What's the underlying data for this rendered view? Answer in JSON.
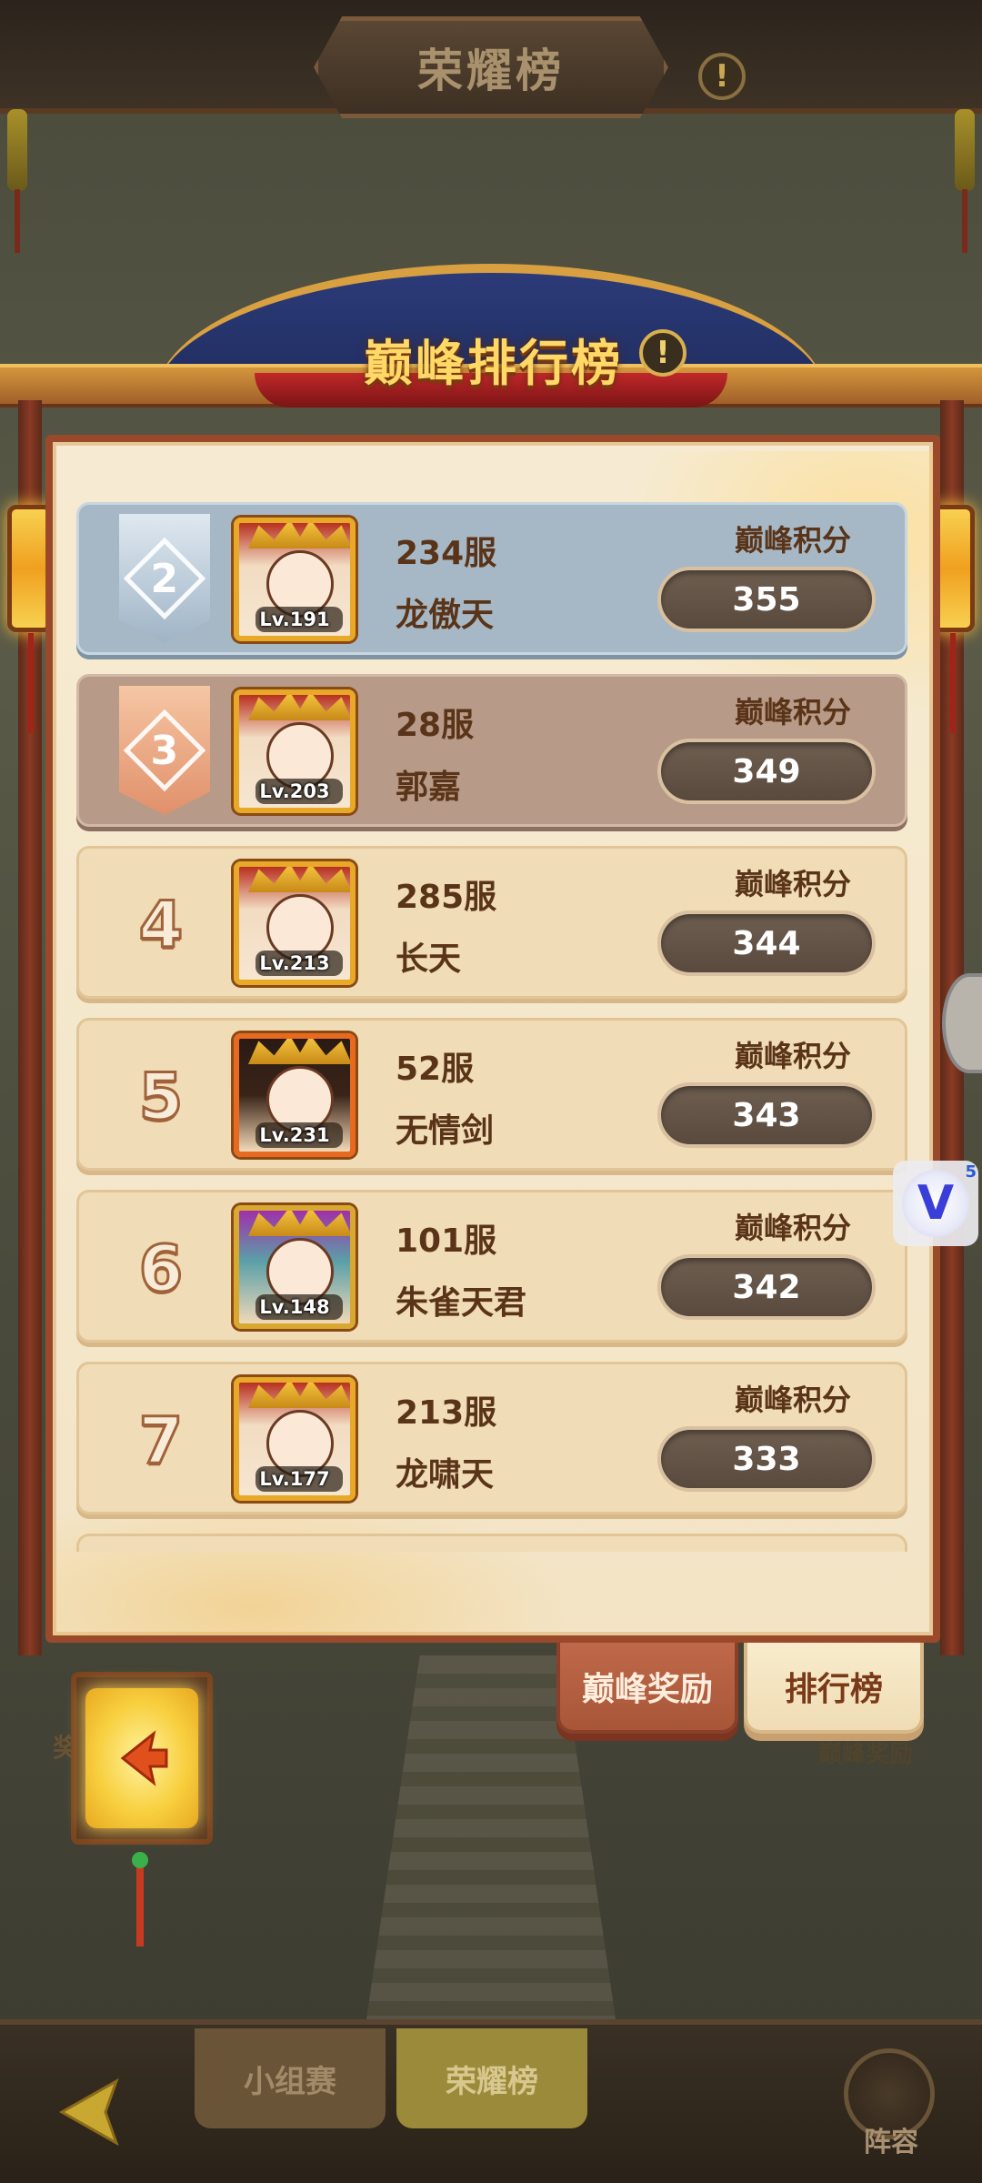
{
  "header": {
    "title": "荣耀榜",
    "info_icon": "info-icon"
  },
  "board": {
    "title": "巅峰排行榜",
    "info_icon": "info-icon"
  },
  "score_label": "巅峰积分",
  "rows": [
    {
      "rank": "2",
      "badge": "silver",
      "server": "234服",
      "name": "龙傲天",
      "level": "Lv.191",
      "score": "355"
    },
    {
      "rank": "3",
      "badge": "bronze",
      "server": "28服",
      "name": "郭嘉",
      "level": "Lv.203",
      "score": "349"
    },
    {
      "rank": "4",
      "badge": "",
      "server": "285服",
      "name": "长天",
      "level": "Lv.213",
      "score": "344"
    },
    {
      "rank": "5",
      "badge": "",
      "server": "52服",
      "name": "无情剑",
      "level": "Lv.231",
      "score": "343"
    },
    {
      "rank": "6",
      "badge": "",
      "server": "101服",
      "name": "朱雀天君",
      "level": "Lv.148",
      "score": "342"
    },
    {
      "rank": "7",
      "badge": "",
      "server": "213服",
      "name": "龙啸天",
      "level": "Lv.177",
      "score": "333"
    }
  ],
  "tabs": {
    "reward": "巅峰奖励",
    "ranking": "排行榜",
    "ghost_reward": "巅峰奖励"
  },
  "side_badge": {
    "letter": "V",
    "count": "5"
  },
  "bottom_nav": {
    "group": "小组赛",
    "honor": "荣耀榜",
    "lineup": "阵容"
  },
  "left_hint": "奖",
  "colors": {
    "panel": "#f6ebd2",
    "frame": "#9a4a2a",
    "title_gold": "#ffd866",
    "score_pill": "#5a4a3e"
  }
}
